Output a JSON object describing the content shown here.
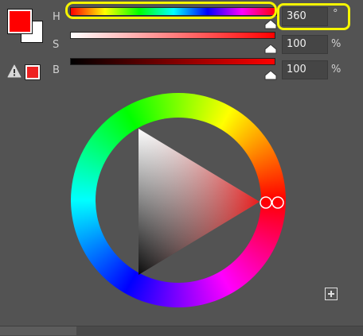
{
  "colors": {
    "foreground": "#ff0000",
    "background": "#ffffff",
    "panel_bg": "#535353",
    "highlight": "#f5f500",
    "gamut_warning_swatch": "#ee2222"
  },
  "channels": [
    {
      "key": "h",
      "label": "H",
      "value": "360",
      "unit": "°",
      "level": 1.0
    },
    {
      "key": "s",
      "label": "S",
      "value": "100",
      "unit": "%",
      "level": 1.0
    },
    {
      "key": "b",
      "label": "B",
      "value": "100",
      "unit": "%",
      "level": 1.0
    }
  ],
  "icons": {
    "gamut_warning": "warning-triangle-icon",
    "expand": "plus-square-icon"
  }
}
